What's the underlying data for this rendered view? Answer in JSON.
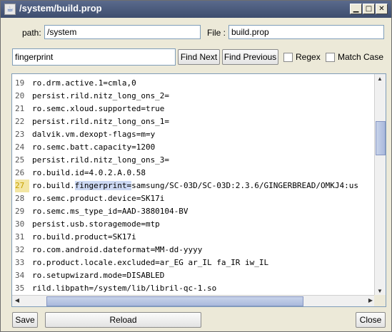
{
  "window": {
    "title": "/system/build.prop"
  },
  "path_row": {
    "path_label": "path:",
    "path_value": "/system",
    "file_label": "File :",
    "file_value": "build.prop"
  },
  "search": {
    "value": "fingerprint",
    "find_next": "Find Next",
    "find_previous": "Find Previous",
    "regex_label": "Regex",
    "match_case_label": "Match Case"
  },
  "editor": {
    "active_line": 27,
    "lines": [
      {
        "num": "19",
        "pre": "ro.drm.active.1=cmla,0"
      },
      {
        "num": "20",
        "pre": "persist.rild.nitz_long_ons_2="
      },
      {
        "num": "21",
        "pre": "ro.semc.xloud.supported=true"
      },
      {
        "num": "22",
        "pre": "persist.rild.nitz_long_ons_1="
      },
      {
        "num": "23",
        "pre": "dalvik.vm.dexopt-flags=m=y"
      },
      {
        "num": "24",
        "pre": "ro.semc.batt.capacity=1200"
      },
      {
        "num": "25",
        "pre": "persist.rild.nitz_long_ons_3="
      },
      {
        "num": "26",
        "pre": "ro.build.id=4.0.2.A.0.58"
      },
      {
        "num": "27",
        "pre": "ro.build.",
        "match": "fingerprint=",
        "post": "samsung/SC-03D/SC-03D:2.3.6/GINGERBREAD/OMKJ4:us"
      },
      {
        "num": "28",
        "pre": "ro.semc.product.device=SK17i"
      },
      {
        "num": "29",
        "pre": "ro.semc.ms_type_id=AAD-3880104-BV"
      },
      {
        "num": "30",
        "pre": "persist.usb.storagemode=mtp"
      },
      {
        "num": "31",
        "pre": "ro.build.product=SK17i"
      },
      {
        "num": "32",
        "pre": "ro.com.android.dateformat=MM-dd-yyyy"
      },
      {
        "num": "33",
        "pre": "ro.product.locale.excluded=ar_EG ar_IL fa_IR iw_IL"
      },
      {
        "num": "34",
        "pre": "ro.setupwizard.mode=DISABLED"
      },
      {
        "num": "35",
        "pre": "rild.libpath=/system/lib/libril-qc-1.so"
      }
    ]
  },
  "footer": {
    "save": "Save",
    "reload": "Reload",
    "close": "Close"
  }
}
